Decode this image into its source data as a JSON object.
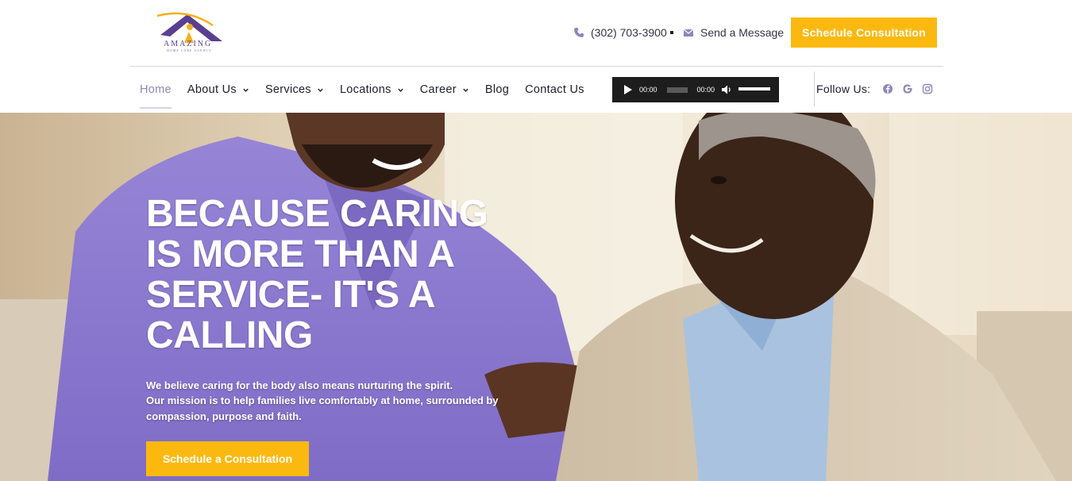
{
  "brand": {
    "logo_text": "AMAZING",
    "logo_subtext": "HOME CARE AGENCY"
  },
  "contact": {
    "phone": "(302) 703-3900",
    "message_label": "Send a Message"
  },
  "header_cta": "Schedule Consultation",
  "nav": {
    "items": [
      {
        "label": "Home",
        "active": true,
        "dropdown": false
      },
      {
        "label": "About Us",
        "active": false,
        "dropdown": true
      },
      {
        "label": "Services",
        "active": false,
        "dropdown": true
      },
      {
        "label": "Locations",
        "active": false,
        "dropdown": true
      },
      {
        "label": "Career",
        "active": false,
        "dropdown": true
      },
      {
        "label": "Blog",
        "active": false,
        "dropdown": false
      },
      {
        "label": "Contact Us",
        "active": false,
        "dropdown": false
      }
    ]
  },
  "audio_player": {
    "current_time": "00:00",
    "duration": "00:00"
  },
  "social": {
    "label": "Follow Us:",
    "icons": [
      "facebook-icon",
      "google-icon",
      "instagram-icon"
    ]
  },
  "hero": {
    "title_lines": [
      "BECAUSE CARING",
      "IS MORE THAN A",
      "SERVICE- IT'S A",
      "CALLING"
    ],
    "text_line1": "We believe caring for the body also means nurturing the spirit.",
    "text_line2": "Our mission is to help families live comfortably at home, surrounded by compassion, purpose and faith.",
    "cta": "Schedule a Consultation"
  },
  "colors": {
    "accent": "#fbb90f",
    "brand_purple": "#5a3f8f",
    "nav_active": "#8f86b8",
    "icon_purple": "#8f86b8"
  }
}
